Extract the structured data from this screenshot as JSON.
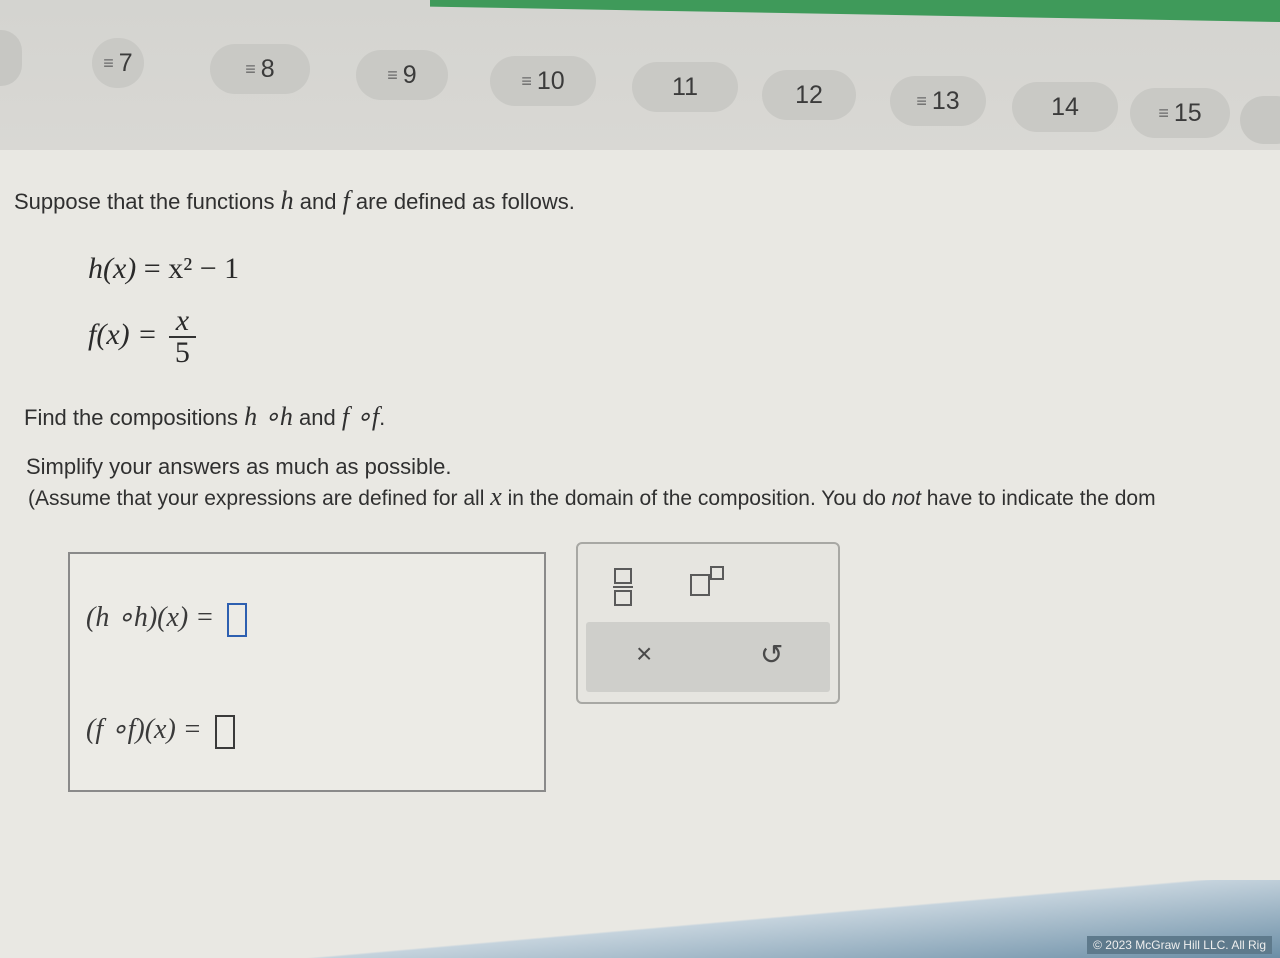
{
  "nav": {
    "questions": [
      {
        "label": "7",
        "flagged": true
      },
      {
        "label": "8",
        "flagged": true
      },
      {
        "label": "9",
        "flagged": true
      },
      {
        "label": "10",
        "flagged": true
      },
      {
        "label": "11",
        "flagged": false
      },
      {
        "label": "12",
        "flagged": false
      },
      {
        "label": "13",
        "flagged": true
      },
      {
        "label": "14",
        "flagged": false
      },
      {
        "label": "15",
        "flagged": true
      }
    ],
    "flag_glyph": "≡"
  },
  "problem": {
    "intro_a": "Suppose that the functions ",
    "var_h": "h",
    "intro_and": " and ",
    "var_f": "f",
    "intro_b": " are defined as follows.",
    "h_def_left": "h(x)",
    "h_def_right": "= x² − 1",
    "f_def_left": "f(x) =",
    "f_num": "x",
    "f_den": "5",
    "find_a": "Find the compositions ",
    "comp_hh": "h ∘h",
    "find_and": " and ",
    "comp_ff": "f ∘f",
    "find_end": ".",
    "simplify": "Simplify your answers as much as possible.",
    "assume_a": "(Assume that your expressions are defined for all ",
    "assume_x": "x",
    "assume_b": " in the domain of the composition. You do ",
    "assume_not": "not",
    "assume_c": " have to indicate the dom"
  },
  "answers": {
    "hh_label": "(h ∘h)(x) =",
    "hh_value": "",
    "ff_label": "(f ∘f)(x) =",
    "ff_value": ""
  },
  "toolbox": {
    "clear_label": "×",
    "undo_label": "↺"
  },
  "footer": {
    "copyright": "© 2023 McGraw Hill LLC. All Rig"
  },
  "colors": {
    "accent_green": "#3f9a5a",
    "active_input": "#2d5fb0"
  }
}
